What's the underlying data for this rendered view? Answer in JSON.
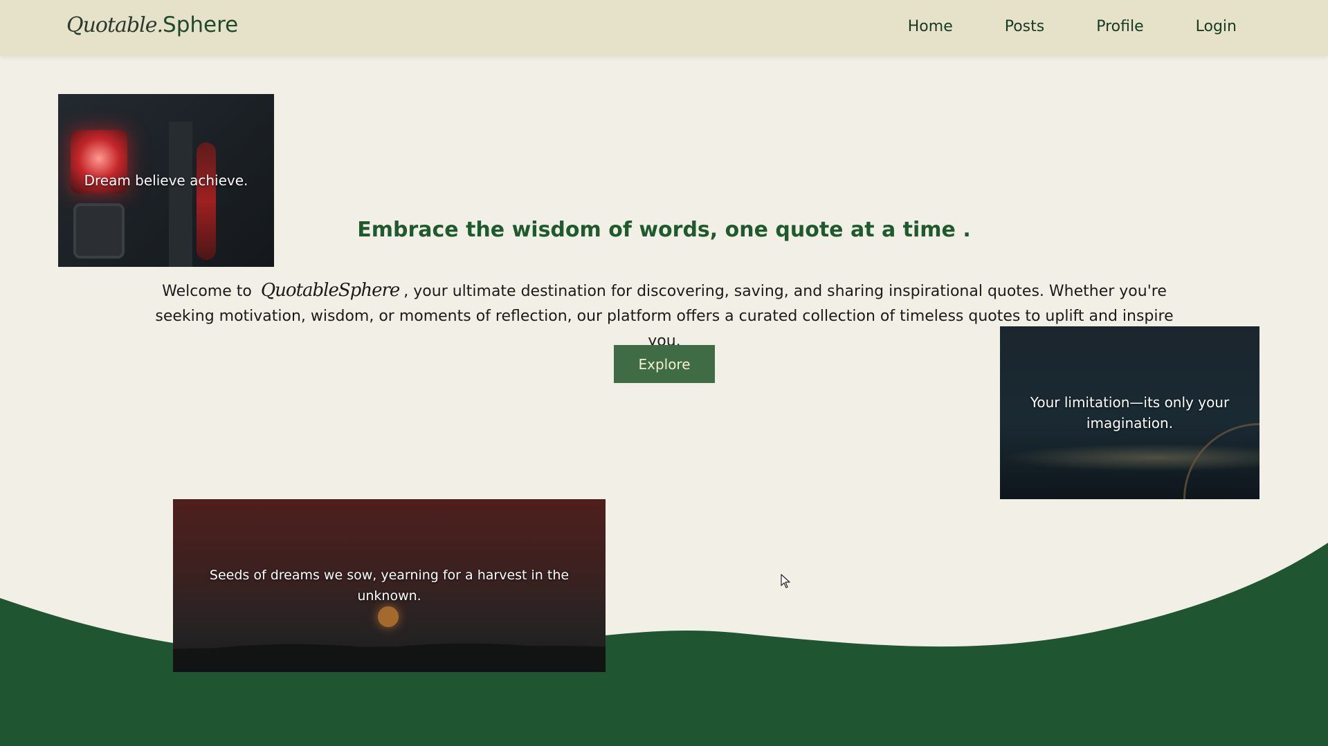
{
  "brand": {
    "script": "Quotable.",
    "sans": "Sphere"
  },
  "nav": {
    "items": [
      "Home",
      "Posts",
      "Profile",
      "Login"
    ]
  },
  "hero": {
    "headline": "Embrace the wisdom of words, one quote at a time .",
    "intro_prefix": "Welcome to",
    "intro_brand": "QuotableSphere",
    "intro_suffix": ", your ultimate destination for discovering, saving, and sharing inspirational quotes. Whether you're seeking motivation, wisdom, or moments of reflection, our platform offers a curated collection of timeless quotes to uplift and inspire you.",
    "button_label": "Explore"
  },
  "quote_cards": [
    {
      "text": "Dream believe achieve."
    },
    {
      "text": "Your limitation—its only your imagination."
    },
    {
      "text": "Seeds of dreams we sow, yearning for a harvest in the unknown."
    }
  ],
  "colors": {
    "navbar_bg": "#e6e1c9",
    "page_bg": "#f2f0e6",
    "accent_green": "#1e5a2e",
    "wave_green": "#1f5530",
    "button_bg": "#3f6b45",
    "button_text": "#f3f0d0"
  }
}
